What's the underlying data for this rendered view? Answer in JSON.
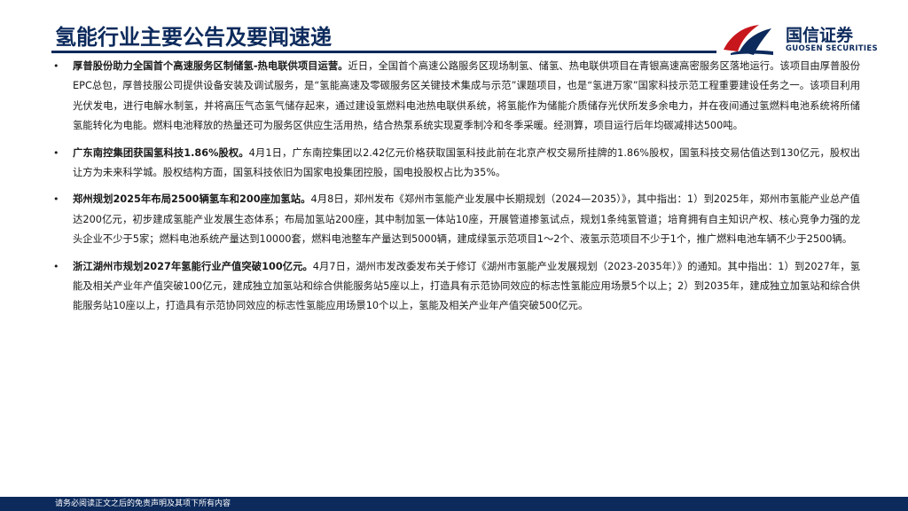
{
  "header": {
    "title": "氢能行业主要公告及要闻速递",
    "brand_cn": "国信证券",
    "brand_en": "GUOSEN SECURITIES"
  },
  "items": [
    {
      "lead": "厚普股份助力全国首个高速服务区制储氢-热电联供项目运营。",
      "body": "近日，全国首个高速公路服务区现场制氢、储氢、热电联供项目在青银高速高密服务区落地运行。该项目由厚普股份EPC总包，厚普技服公司提供设备安装及调试服务，是“氢能高速及零碳服务区关键技术集成与示范”课题项目，也是“氢进万家”国家科技示范工程重要建设任务之一。该项目利用光伏发电，进行电解水制氢，并将高压气态氢气储存起来，通过建设氢燃料电池热电联供系统，将氢能作为储能介质储存光伏所发多余电力，并在夜间通过氢燃料电池系统将所储氢能转化为电能。燃料电池释放的热量还可为服务区供应生活用热，结合热泵系统实现夏季制冷和冬季采暖。经测算，项目运行后年均碳减排达500吨。"
    },
    {
      "lead": "广东南控集团获国氢科技1.86%股权。",
      "body": "4月1日，广东南控集团以2.42亿元价格获取国氢科技此前在北京产权交易所挂牌的1.86%股权，国氢科技交易估值达到130亿元，股权出让方为未来科学城。股权结构方面，国氢科技依旧为国家电投集团控股，国电投股权占比为35%。"
    },
    {
      "lead": "郑州规划2025年布局2500辆氢车和200座加氢站。",
      "body": "4月8日，郑州发布《郑州市氢能产业发展中长期规划（2024—2035）》，其中指出：1）到2025年，郑州市氢能产业总产值达200亿元，初步建成氢能产业发展生态体系；布局加氢站200座，其中制加氢一体站10座，开展管道掺氢试点，规划1条纯氢管道；培育拥有自主知识产权、核心竞争力强的龙头企业不少于5家；燃料电池系统产量达到10000套，燃料电池整车产量达到5000辆，建成绿氢示范项目1～2个、液氢示范项目不少于1个，推广燃料电池车辆不少于2500辆。"
    },
    {
      "lead": "浙江湖州市规划2027年氢能行业产值突破100亿元。",
      "body": "4月7日，湖州市发改委发布关于修订《湖州市氢能产业发展规划（2023-2035年）》的通知。其中指出：1）到2027年，氢能及相关产业年产值突破100亿元，建成独立加氢站和综合供能服务站5座以上，打造具有示范协同效应的标志性氢能应用场景5个以上；2）到2035年，建成独立加氢站和综合供能服务站10座以上，打造具有示范协同效应的标志性氢能应用场景10个以上，氢能及相关产业年产值突破500亿元。"
    }
  ],
  "bullet_char": "•",
  "footer": {
    "disclaimer": "请务必阅读正文之后的免责声明及其项下所有内容"
  },
  "colors": {
    "navy": "#0c2a5c",
    "red": "#c8161d"
  },
  "icons": {
    "logo": "guosen-logo-icon"
  }
}
